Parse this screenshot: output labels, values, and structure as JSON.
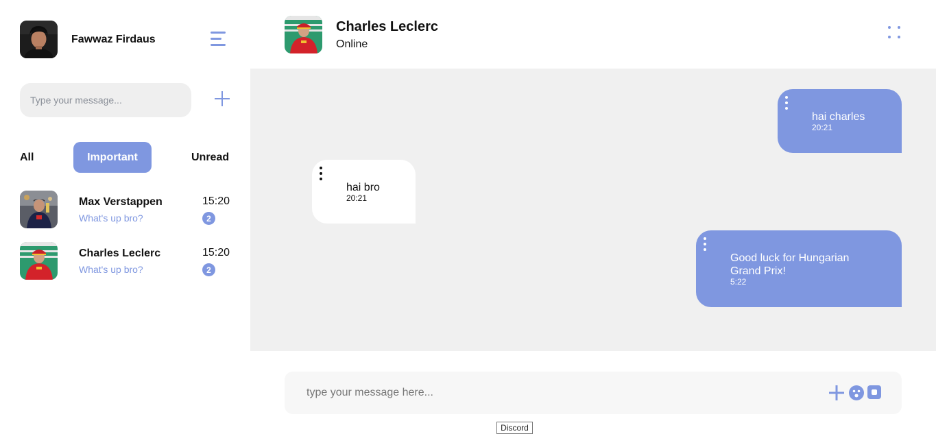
{
  "user": {
    "name": "Fawwaz Firdaus"
  },
  "sidebar": {
    "search_placeholder": "Type your message...",
    "tabs": [
      {
        "label": "All"
      },
      {
        "label": "Important"
      },
      {
        "label": "Unread"
      }
    ],
    "contacts": [
      {
        "name": "Max Verstappen",
        "preview": "What's up bro?",
        "time": "15:20",
        "unread": "2"
      },
      {
        "name": "Charles Leclerc",
        "preview": "What's up bro?",
        "time": "15:20",
        "unread": "2"
      }
    ]
  },
  "chat": {
    "name": "Charles Leclerc",
    "status": "Online",
    "messages": [
      {
        "direction": "out",
        "text": "hai charles",
        "time": "20:21"
      },
      {
        "direction": "in",
        "text": "hai bro",
        "time": "20:21"
      },
      {
        "direction": "out",
        "text": "Good luck for Hungarian Grand Prix!",
        "time": "5:22"
      }
    ]
  },
  "composer": {
    "placeholder": "type your message here..."
  },
  "tooltip": {
    "label": "Discord"
  },
  "colors": {
    "accent": "#7f97e0",
    "chat_background": "#f0f0f0",
    "input_background": "#efefef"
  },
  "icons": {
    "menu": "hamburger-menu-icon",
    "add": "plus-icon",
    "more": "dots-grid-icon",
    "emoji": "emoji-icon",
    "camera": "camera-icon"
  }
}
